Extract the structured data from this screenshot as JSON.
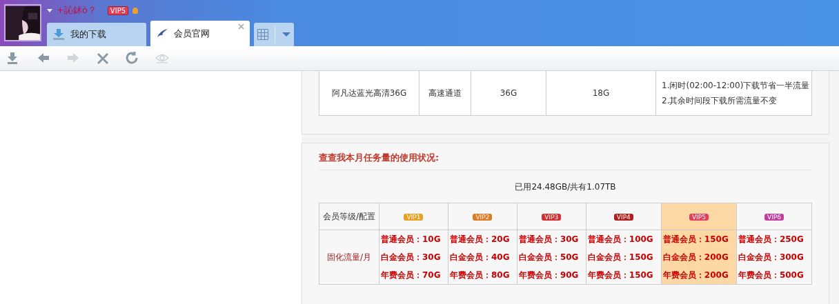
{
  "header": {
    "username": "+訫鉥ò？",
    "vip_badge": "VIP5"
  },
  "tabs": [
    {
      "label": "我的下载",
      "selected": false,
      "kind": "download"
    },
    {
      "label": "会员官网",
      "selected": true,
      "kind": "web"
    }
  ],
  "toolbar": [
    {
      "kind": "download",
      "disabled": false
    },
    {
      "kind": "back",
      "disabled": false
    },
    {
      "kind": "forward",
      "disabled": true
    },
    {
      "kind": "stop",
      "disabled": false
    },
    {
      "kind": "refresh",
      "disabled": false
    },
    {
      "kind": "view",
      "disabled": true
    }
  ],
  "package_table": {
    "rows": [
      {
        "name": "阿凡达蓝光高清36G",
        "channel": "高速通道",
        "size": "36G",
        "cost": "18G",
        "notes": [
          "1.闲时(02:00-12:00)下载节省一半流量",
          "2.其余时间段下载所需流量不变"
        ]
      }
    ]
  },
  "usage": {
    "title": "查查我本月任务量的使用状况:",
    "summary": "已用24.48GB/共有1.07TB",
    "row_headers": [
      "会员等级/配置",
      "固化流量/月"
    ],
    "levels": [
      {
        "badge": "VIP1",
        "color": "#e8a020",
        "selected": false,
        "quotas": [
          "普通会员：10G",
          "白金会员：30G",
          "年费会员：70G"
        ]
      },
      {
        "badge": "VIP2",
        "color": "#e07a20",
        "selected": false,
        "quotas": [
          "普通会员：20G",
          "白金会员：40G",
          "年费会员：80G"
        ]
      },
      {
        "badge": "VIP3",
        "color": "#d03030",
        "selected": false,
        "quotas": [
          "普通会员：30G",
          "白金会员：50G",
          "年费会员：90G"
        ]
      },
      {
        "badge": "VIP4",
        "color": "#b02020",
        "selected": false,
        "quotas": [
          "普通会员：100G",
          "白金会员：150G",
          "年费会员：150G"
        ]
      },
      {
        "badge": "VIP5",
        "color": "#e04060",
        "selected": true,
        "quotas": [
          "普通会员：150G",
          "白金会员：200G",
          "年费会员：200G"
        ]
      },
      {
        "badge": "VIP6",
        "color": "#c040a0",
        "selected": false,
        "quotas": [
          "普通会员：250G",
          "白金会员：300G",
          "年费会员：500G"
        ]
      }
    ]
  }
}
